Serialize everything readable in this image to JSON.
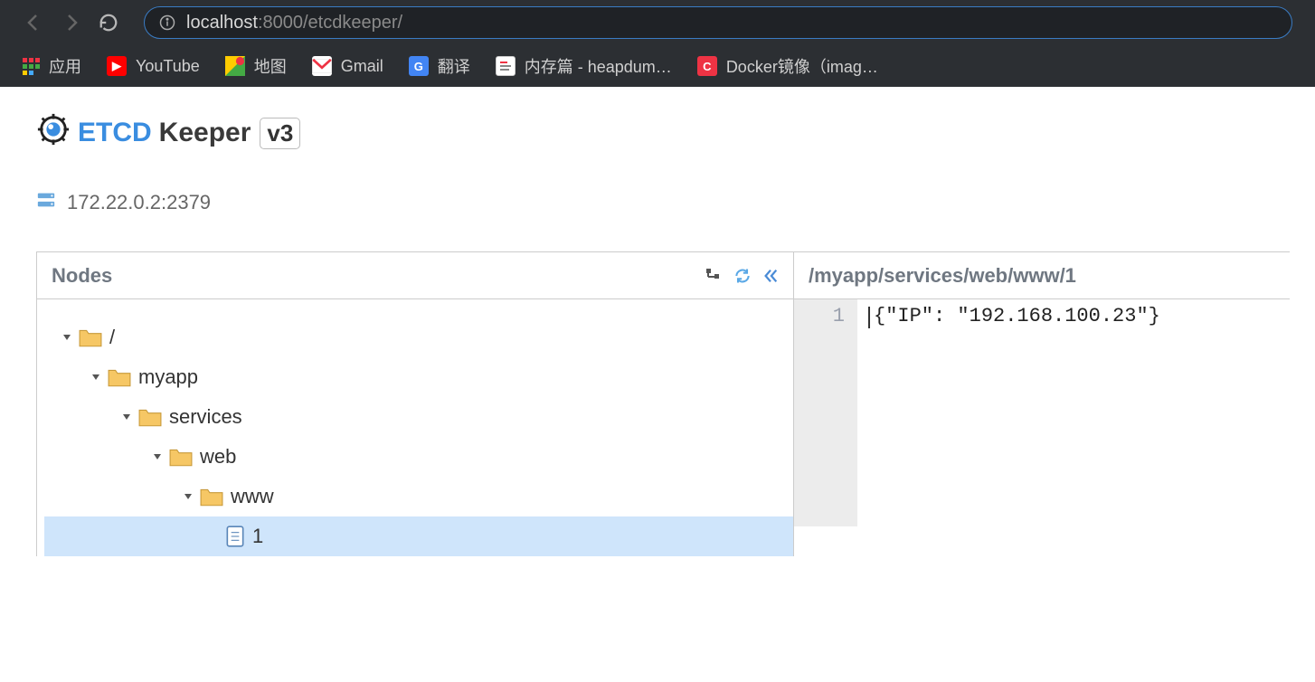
{
  "browser": {
    "url_host": "localhost",
    "url_port": ":8000",
    "url_path": "/etcdkeeper/",
    "bookmarks": [
      {
        "label": "应用",
        "icon": "apps"
      },
      {
        "label": "YouTube",
        "icon": "youtube"
      },
      {
        "label": "地图",
        "icon": "maps"
      },
      {
        "label": "Gmail",
        "icon": "gmail"
      },
      {
        "label": "翻译",
        "icon": "translate"
      },
      {
        "label": "内存篇 - heapdum…",
        "icon": "cnblogs"
      },
      {
        "label": "Docker镜像（imag…",
        "icon": "c-red"
      }
    ]
  },
  "app": {
    "title_brand": "ETCD",
    "title_rest": "Keeper",
    "version": "v3",
    "server_address": "172.22.0.2:2379"
  },
  "left_panel": {
    "header": "Nodes",
    "tree": [
      {
        "label": "/",
        "depth": 0,
        "type": "folder",
        "expanded": true
      },
      {
        "label": "myapp",
        "depth": 1,
        "type": "folder",
        "expanded": true
      },
      {
        "label": "services",
        "depth": 2,
        "type": "folder",
        "expanded": true
      },
      {
        "label": "web",
        "depth": 3,
        "type": "folder",
        "expanded": true
      },
      {
        "label": "www",
        "depth": 4,
        "type": "folder",
        "expanded": true
      },
      {
        "label": "1",
        "depth": 5,
        "type": "file",
        "expanded": false,
        "selected": true
      }
    ]
  },
  "right_panel": {
    "path": "/myapp/services/web/www/1",
    "line_number": "1",
    "content": "{\"IP\": \"192.168.100.23\"}"
  }
}
